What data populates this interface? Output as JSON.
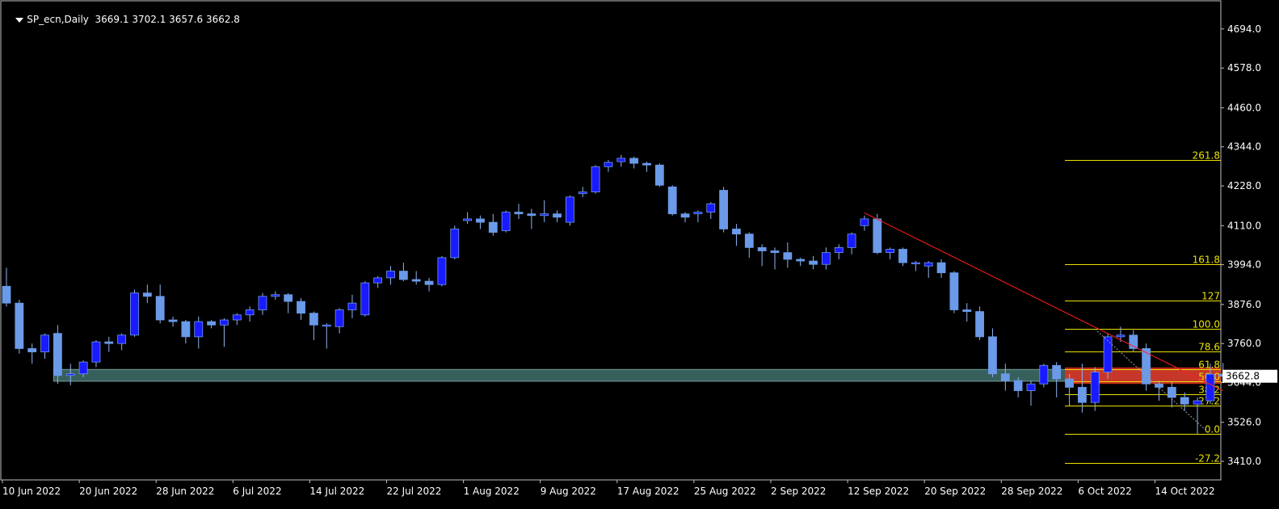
{
  "header": {
    "symbol": "SP_ecn,Daily",
    "ohlc": "3669.1 3702.1 3657.6 3662.8"
  },
  "colors": {
    "background": "#000000",
    "frame": "#c0c0c0",
    "axis_text": "#ffffff",
    "bull_candle": "#1a1aff",
    "bear_candle": "#6a9ae8",
    "wick": "#8fb3f0",
    "fib": "#e8e000",
    "fib_zone": "#e03020",
    "trendline": "#ff2020",
    "support_zone": "#3e6a66",
    "price_tag_bg": "#ffffff",
    "price_tag_text": "#000000"
  },
  "chart_data": {
    "type": "candlestick",
    "title": "SP_ecn,Daily",
    "ylim": [
      3355,
      4780
    ],
    "y_ticks": [
      "4694.0",
      "4578.0",
      "4460.0",
      "4344.0",
      "4228.0",
      "4110.0",
      "3994.0",
      "3876.0",
      "3760.0",
      "3644.0",
      "3526.0",
      "3410.0"
    ],
    "x_labels": [
      {
        "label": "10 Jun 2022",
        "index": 0
      },
      {
        "label": "20 Jun 2022",
        "index": 6
      },
      {
        "label": "28 Jun 2022",
        "index": 12
      },
      {
        "label": "6 Jul 2022",
        "index": 18
      },
      {
        "label": "14 Jul 2022",
        "index": 24
      },
      {
        "label": "22 Jul 2022",
        "index": 30
      },
      {
        "label": "1 Aug 2022",
        "index": 36
      },
      {
        "label": "9 Aug 2022",
        "index": 42
      },
      {
        "label": "17 Aug 2022",
        "index": 48
      },
      {
        "label": "25 Aug 2022",
        "index": 54
      },
      {
        "label": "2 Sep 2022",
        "index": 60
      },
      {
        "label": "12 Sep 2022",
        "index": 66
      },
      {
        "label": "20 Sep 2022",
        "index": 72
      },
      {
        "label": "28 Sep 2022",
        "index": 78
      },
      {
        "label": "6 Oct 2022",
        "index": 84
      },
      {
        "label": "14 Oct 2022",
        "index": 90
      }
    ],
    "candles": [
      {
        "o": 3930,
        "h": 3985,
        "l": 3870,
        "c": 3880
      },
      {
        "o": 3880,
        "h": 3890,
        "l": 3730,
        "c": 3745
      },
      {
        "o": 3745,
        "h": 3760,
        "l": 3700,
        "c": 3735
      },
      {
        "o": 3735,
        "h": 3790,
        "l": 3715,
        "c": 3785
      },
      {
        "o": 3790,
        "h": 3815,
        "l": 3640,
        "c": 3665
      },
      {
        "o": 3665,
        "h": 3700,
        "l": 3636,
        "c": 3670
      },
      {
        "o": 3670,
        "h": 3710,
        "l": 3660,
        "c": 3705
      },
      {
        "o": 3705,
        "h": 3770,
        "l": 3690,
        "c": 3765
      },
      {
        "o": 3765,
        "h": 3780,
        "l": 3735,
        "c": 3760
      },
      {
        "o": 3760,
        "h": 3790,
        "l": 3740,
        "c": 3785
      },
      {
        "o": 3785,
        "h": 3920,
        "l": 3780,
        "c": 3910
      },
      {
        "o": 3910,
        "h": 3935,
        "l": 3880,
        "c": 3900
      },
      {
        "o": 3900,
        "h": 3935,
        "l": 3820,
        "c": 3830
      },
      {
        "o": 3830,
        "h": 3840,
        "l": 3810,
        "c": 3825
      },
      {
        "o": 3825,
        "h": 3830,
        "l": 3760,
        "c": 3780
      },
      {
        "o": 3780,
        "h": 3840,
        "l": 3745,
        "c": 3825
      },
      {
        "o": 3825,
        "h": 3830,
        "l": 3805,
        "c": 3815
      },
      {
        "o": 3815,
        "h": 3835,
        "l": 3750,
        "c": 3830
      },
      {
        "o": 3830,
        "h": 3850,
        "l": 3815,
        "c": 3845
      },
      {
        "o": 3845,
        "h": 3870,
        "l": 3825,
        "c": 3860
      },
      {
        "o": 3860,
        "h": 3910,
        "l": 3845,
        "c": 3900
      },
      {
        "o": 3900,
        "h": 3915,
        "l": 3890,
        "c": 3905
      },
      {
        "o": 3905,
        "h": 3910,
        "l": 3850,
        "c": 3885
      },
      {
        "o": 3885,
        "h": 3895,
        "l": 3830,
        "c": 3850
      },
      {
        "o": 3850,
        "h": 3855,
        "l": 3770,
        "c": 3815
      },
      {
        "o": 3815,
        "h": 3820,
        "l": 3745,
        "c": 3815
      },
      {
        "o": 3810,
        "h": 3865,
        "l": 3790,
        "c": 3860
      },
      {
        "o": 3860,
        "h": 3905,
        "l": 3835,
        "c": 3880
      },
      {
        "o": 3845,
        "h": 3945,
        "l": 3840,
        "c": 3940
      },
      {
        "o": 3940,
        "h": 3960,
        "l": 3925,
        "c": 3955
      },
      {
        "o": 3955,
        "h": 3990,
        "l": 3935,
        "c": 3975
      },
      {
        "o": 3975,
        "h": 4000,
        "l": 3945,
        "c": 3950
      },
      {
        "o": 3950,
        "h": 3975,
        "l": 3935,
        "c": 3945
      },
      {
        "o": 3945,
        "h": 3955,
        "l": 3915,
        "c": 3935
      },
      {
        "o": 3935,
        "h": 4020,
        "l": 3930,
        "c": 4015
      },
      {
        "o": 4015,
        "h": 4110,
        "l": 4010,
        "c": 4100
      },
      {
        "o": 4125,
        "h": 4150,
        "l": 4115,
        "c": 4130
      },
      {
        "o": 4130,
        "h": 4140,
        "l": 4100,
        "c": 4120
      },
      {
        "o": 4120,
        "h": 4145,
        "l": 4080,
        "c": 4090
      },
      {
        "o": 4095,
        "h": 4155,
        "l": 4090,
        "c": 4150
      },
      {
        "o": 4150,
        "h": 4175,
        "l": 4130,
        "c": 4145
      },
      {
        "o": 4145,
        "h": 4160,
        "l": 4100,
        "c": 4140
      },
      {
        "o": 4140,
        "h": 4185,
        "l": 4120,
        "c": 4145
      },
      {
        "o": 4145,
        "h": 4155,
        "l": 4120,
        "c": 4135
      },
      {
        "o": 4120,
        "h": 4200,
        "l": 4110,
        "c": 4195
      },
      {
        "o": 4205,
        "h": 4225,
        "l": 4195,
        "c": 4210
      },
      {
        "o": 4210,
        "h": 4290,
        "l": 4205,
        "c": 4285
      },
      {
        "o": 4285,
        "h": 4305,
        "l": 4270,
        "c": 4298
      },
      {
        "o": 4300,
        "h": 4320,
        "l": 4285,
        "c": 4310
      },
      {
        "o": 4310,
        "h": 4315,
        "l": 4280,
        "c": 4295
      },
      {
        "o": 4295,
        "h": 4300,
        "l": 4270,
        "c": 4290
      },
      {
        "o": 4290,
        "h": 4295,
        "l": 4225,
        "c": 4230
      },
      {
        "o": 4225,
        "h": 4230,
        "l": 4140,
        "c": 4145
      },
      {
        "o": 4145,
        "h": 4150,
        "l": 4120,
        "c": 4135
      },
      {
        "o": 4145,
        "h": 4155,
        "l": 4120,
        "c": 4150
      },
      {
        "o": 4150,
        "h": 4180,
        "l": 4130,
        "c": 4175
      },
      {
        "o": 4215,
        "h": 4225,
        "l": 4090,
        "c": 4100
      },
      {
        "o": 4100,
        "h": 4115,
        "l": 4050,
        "c": 4085
      },
      {
        "o": 4085,
        "h": 4090,
        "l": 4015,
        "c": 4045
      },
      {
        "o": 4045,
        "h": 4055,
        "l": 3990,
        "c": 4035
      },
      {
        "o": 4035,
        "h": 4045,
        "l": 3980,
        "c": 4030
      },
      {
        "o": 4030,
        "h": 4060,
        "l": 3985,
        "c": 4010
      },
      {
        "o": 4010,
        "h": 4015,
        "l": 3990,
        "c": 4005
      },
      {
        "o": 4005,
        "h": 4020,
        "l": 3980,
        "c": 3995
      },
      {
        "o": 3995,
        "h": 4045,
        "l": 3980,
        "c": 4030
      },
      {
        "o": 4030,
        "h": 4055,
        "l": 4010,
        "c": 4045
      },
      {
        "o": 4045,
        "h": 4090,
        "l": 4025,
        "c": 4085
      },
      {
        "o": 4110,
        "h": 4140,
        "l": 4095,
        "c": 4130
      },
      {
        "o": 4130,
        "h": 4145,
        "l": 4025,
        "c": 4030
      },
      {
        "o": 4030,
        "h": 4045,
        "l": 4010,
        "c": 4040
      },
      {
        "o": 4040,
        "h": 4045,
        "l": 3990,
        "c": 4000
      },
      {
        "o": 4000,
        "h": 4005,
        "l": 3975,
        "c": 4000
      },
      {
        "o": 3990,
        "h": 4005,
        "l": 3955,
        "c": 4000
      },
      {
        "o": 4000,
        "h": 4010,
        "l": 3955,
        "c": 3970
      },
      {
        "o": 3970,
        "h": 3975,
        "l": 3850,
        "c": 3860
      },
      {
        "o": 3860,
        "h": 3880,
        "l": 3825,
        "c": 3855
      },
      {
        "o": 3855,
        "h": 3870,
        "l": 3770,
        "c": 3780
      },
      {
        "o": 3780,
        "h": 3805,
        "l": 3660,
        "c": 3670
      },
      {
        "o": 3670,
        "h": 3700,
        "l": 3620,
        "c": 3650
      },
      {
        "o": 3650,
        "h": 3660,
        "l": 3600,
        "c": 3620
      },
      {
        "o": 3620,
        "h": 3650,
        "l": 3575,
        "c": 3640
      },
      {
        "o": 3640,
        "h": 3700,
        "l": 3630,
        "c": 3695
      },
      {
        "o": 3695,
        "h": 3705,
        "l": 3600,
        "c": 3655
      },
      {
        "o": 3655,
        "h": 3670,
        "l": 3575,
        "c": 3630
      },
      {
        "o": 3630,
        "h": 3700,
        "l": 3555,
        "c": 3585
      },
      {
        "o": 3585,
        "h": 3690,
        "l": 3560,
        "c": 3675
      },
      {
        "o": 3675,
        "h": 3790,
        "l": 3655,
        "c": 3780
      },
      {
        "o": 3780,
        "h": 3810,
        "l": 3765,
        "c": 3785
      },
      {
        "o": 3785,
        "h": 3800,
        "l": 3735,
        "c": 3745
      },
      {
        "o": 3745,
        "h": 3760,
        "l": 3620,
        "c": 3640
      },
      {
        "o": 3640,
        "h": 3650,
        "l": 3590,
        "c": 3630
      },
      {
        "o": 3630,
        "h": 3645,
        "l": 3570,
        "c": 3600
      },
      {
        "o": 3600,
        "h": 3615,
        "l": 3560,
        "c": 3580
      },
      {
        "o": 3580,
        "h": 3600,
        "l": 3491,
        "c": 3590
      },
      {
        "o": 3590,
        "h": 3700,
        "l": 3580,
        "c": 3669
      },
      {
        "o": 3669,
        "h": 3702,
        "l": 3657,
        "c": 3663
      }
    ],
    "current_price": "3662.8",
    "fibonacci": {
      "anchor_high": 3803,
      "anchor_low": 3491,
      "levels": [
        {
          "label": "261.8",
          "price": 4306
        },
        {
          "label": "161.8",
          "price": 3996
        },
        {
          "label": "127",
          "price": 3888
        },
        {
          "label": "100.0",
          "price": 3803
        },
        {
          "label": "78.6",
          "price": 3736
        },
        {
          "label": "61.8",
          "price": 3684
        },
        {
          "label": "50.0",
          "price": 3647
        },
        {
          "label": "38.2",
          "price": 3610
        },
        {
          "label": "27.2",
          "price": 3576
        },
        {
          "label": "0.0",
          "price": 3491
        },
        {
          "label": "-27.2",
          "price": 3406
        }
      ],
      "zone_top": 3689,
      "zone_bottom": 3640
    },
    "trendline": {
      "start_index": 67,
      "start_price": 4148,
      "end_index": 95,
      "end_price": 3620
    },
    "support_zone": {
      "start_index": 4,
      "top": 3683,
      "bottom": 3648
    },
    "grid": false,
    "legend": "none"
  }
}
